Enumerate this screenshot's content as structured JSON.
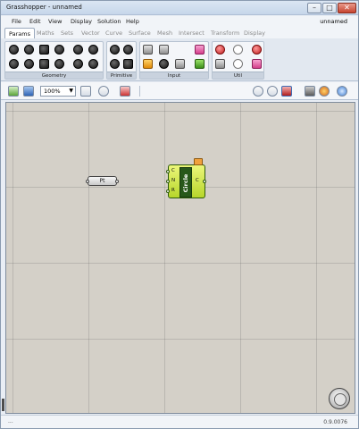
{
  "window": {
    "title": "Grasshopper - unnamed",
    "controls": {
      "minimize": "–",
      "maximize": "□",
      "close": "✕"
    }
  },
  "menu": {
    "items": [
      "File",
      "Edit",
      "View",
      "Display",
      "Solution",
      "Help"
    ],
    "document_name": "unnamed"
  },
  "tabs": [
    "Params",
    "Maths",
    "Sets",
    "Vector",
    "Curve",
    "Surface",
    "Mesh",
    "Intersect",
    "Transform",
    "Display"
  ],
  "ribbon": {
    "panels": [
      "Geometry",
      "Primitive",
      "Input",
      "Util"
    ]
  },
  "toolbar": {
    "zoom": "100%"
  },
  "canvas": {
    "point_node_label": "Pt",
    "circle_node": {
      "name": "Circle",
      "inputs": [
        "C",
        "N",
        "R"
      ],
      "output": "C"
    }
  },
  "status": {
    "left": "...",
    "version": "0.9.0076"
  },
  "colors": {
    "canvas": "#d4d0c8",
    "component_fill": "#d6ea4a",
    "component_body": "#27581a",
    "flag": "#f0a13c"
  }
}
